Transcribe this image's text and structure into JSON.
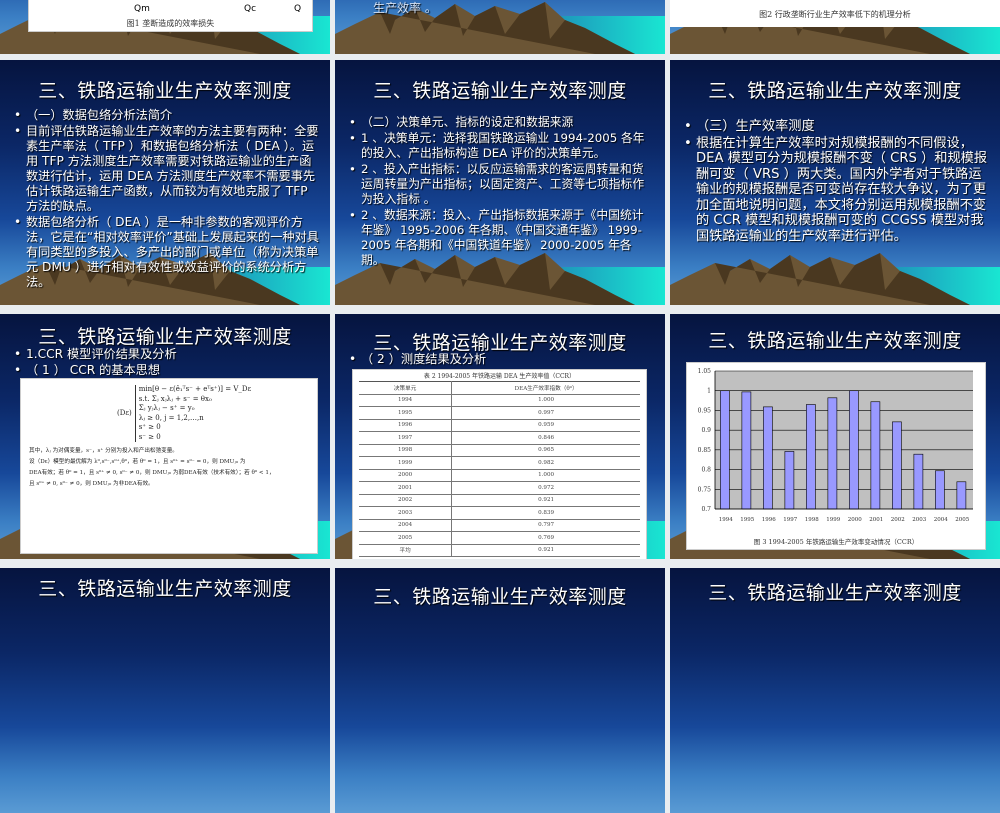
{
  "slides_top": {
    "s1": {
      "axis_labels": [
        "Qm",
        "Qc",
        "Q"
      ],
      "caption": "图1  垄断造成的效率损失"
    },
    "s2": {
      "text": "生产效率 。"
    },
    "s3": {
      "caption": "图2  行政垄断行业生产效率低下的机理分析"
    }
  },
  "section_title": "三、铁路运输业生产效率测度",
  "slide4": {
    "bullets": [
      "（一）数据包络分析法简介",
      "目前评估铁路运输业生产效率的方法主要有两种：全要素生产率法（ TFP ）和数据包络分析法（ DEA ）。运用 TFP 方法测度生产效率需要对铁路运输业的生产函数进行估计，运用 DEA 方法测度生产效率不需要事先估计铁路运输生产函数，从而较为有效地克服了 TFP 方法的缺点。",
      "数据包络分析（ DEA ）是一种非参数的客观评价方法，它是在“相对效率评价”基础上发展起来的一种对具有同类型的多投入、多产出的部门或单位（称为决策单元 DMU ）进行相对有效性或效益评价的系统分析方法。"
    ]
  },
  "slide5": {
    "bullets": [
      "（二）决策单元、指标的设定和数据来源",
      "1 、决策单元：选择我国铁路运输业 1994-2005 各年的投入、产出指标构造 DEA 评价的决策单元。",
      "2 、投入产出指标：以反应运输需求的客运周转量和货运周转量为产出指标；以固定资产、工资等七项指标作为投入指标 。",
      "2 、数据来源：投入、产出指标数据来源于《中国统计年鉴》 1995-2006 年各期、《中国交通年鉴》 1999-2005 年各期和《中国铁道年鉴》 2000-2005 年各期。"
    ]
  },
  "slide6": {
    "bullets": [
      "（三）生产效率测度",
      "根据在计算生产效率时对规模报酬的不同假设， DEA 模型可分为规模报酬不变（ CRS ）和规模报酬可变（ VRS ）两大类。国内外学者对于铁路运输业的规模报酬是否可变尚存在较大争议，为了更加全面地说明问题，本文将分别运用规模报酬不变的 CCR 模型和规模报酬可变的 CCGSS 模型对我国铁路运输业的生产效率进行评估。"
    ]
  },
  "slide7": {
    "bullets": [
      "1.CCR 模型评价结果及分析",
      "（ 1 ） CCR 的基本思想"
    ],
    "formula": {
      "label": "(Dε)",
      "lines": [
        "min[θ − ε(ê₁ᵀs⁻ + eᵀs⁺)] = V_Dε",
        "s.t. Σⱼ xⱼλⱼ + s⁻ = θx₀",
        "Σⱼ yⱼλⱼ − s⁺ = y₀",
        "λⱼ ≥ 0, j = 1,2,…,n",
        "s⁺ ≥ 0",
        "s⁻ ≥ 0"
      ],
      "notes": [
        "其中，λⱼ 为对偶变量，s⁻，s⁺ 分别为投入和产出松弛变量。",
        "设（Dε）模型的最优解为 λ⁰,s⁰⁻,s⁰⁺,θ⁰，若 θ⁰ = 1，且 s⁰⁺ = s⁰⁻ = 0，则 DMUⱼ₀ 为",
        "DEA有效；若 θ⁰ = 1，且 s⁰⁺ ≠ 0, s⁰⁻ ≠ 0，则 DMUⱼ₀ 为弱DEA有效（技术有效）；若 θ⁰ < 1，",
        "且 s⁰⁺ ≠ 0, s⁰⁻ ≠ 0，则 DMUⱼ₀ 为非DEA有效。"
      ]
    }
  },
  "slide8": {
    "bullets": [
      "（ 2 ）测度结果及分析"
    ],
    "table": {
      "caption": "表 2  1994-2005 年铁路运输 DEA 生产效率值（CCR）",
      "headers": [
        "决策单元",
        "DEA生产效率指数（θ⁰）"
      ],
      "rows": [
        [
          "1994",
          "1.000"
        ],
        [
          "1995",
          "0.997"
        ],
        [
          "1996",
          "0.959"
        ],
        [
          "1997",
          "0.846"
        ],
        [
          "1998",
          "0.965"
        ],
        [
          "1999",
          "0.982"
        ],
        [
          "2000",
          "1.000"
        ],
        [
          "2001",
          "0.972"
        ],
        [
          "2002",
          "0.921"
        ],
        [
          "2003",
          "0.839"
        ],
        [
          "2004",
          "0.797"
        ],
        [
          "2005",
          "0.769"
        ],
        [
          "平均",
          "0.921"
        ]
      ]
    }
  },
  "chart_data": {
    "type": "bar",
    "title": "",
    "caption": "图 3  1994-2005 年铁路运输生产效率变动情况（CCR）",
    "categories": [
      "1994",
      "1995",
      "1996",
      "1997",
      "1998",
      "1999",
      "2000",
      "2001",
      "2002",
      "2003",
      "2004",
      "2005"
    ],
    "values": [
      1.0,
      0.997,
      0.959,
      0.846,
      0.965,
      0.982,
      1.0,
      0.972,
      0.921,
      0.839,
      0.797,
      0.769
    ],
    "ylim": [
      0.7,
      1.05
    ],
    "yticks": [
      "0.7",
      "0.75",
      "0.8",
      "0.85",
      "0.9",
      "0.95",
      "1",
      "1.05"
    ],
    "grid": true,
    "bar_color": "#9999ff",
    "plot_bg": "#c0c0c0"
  }
}
